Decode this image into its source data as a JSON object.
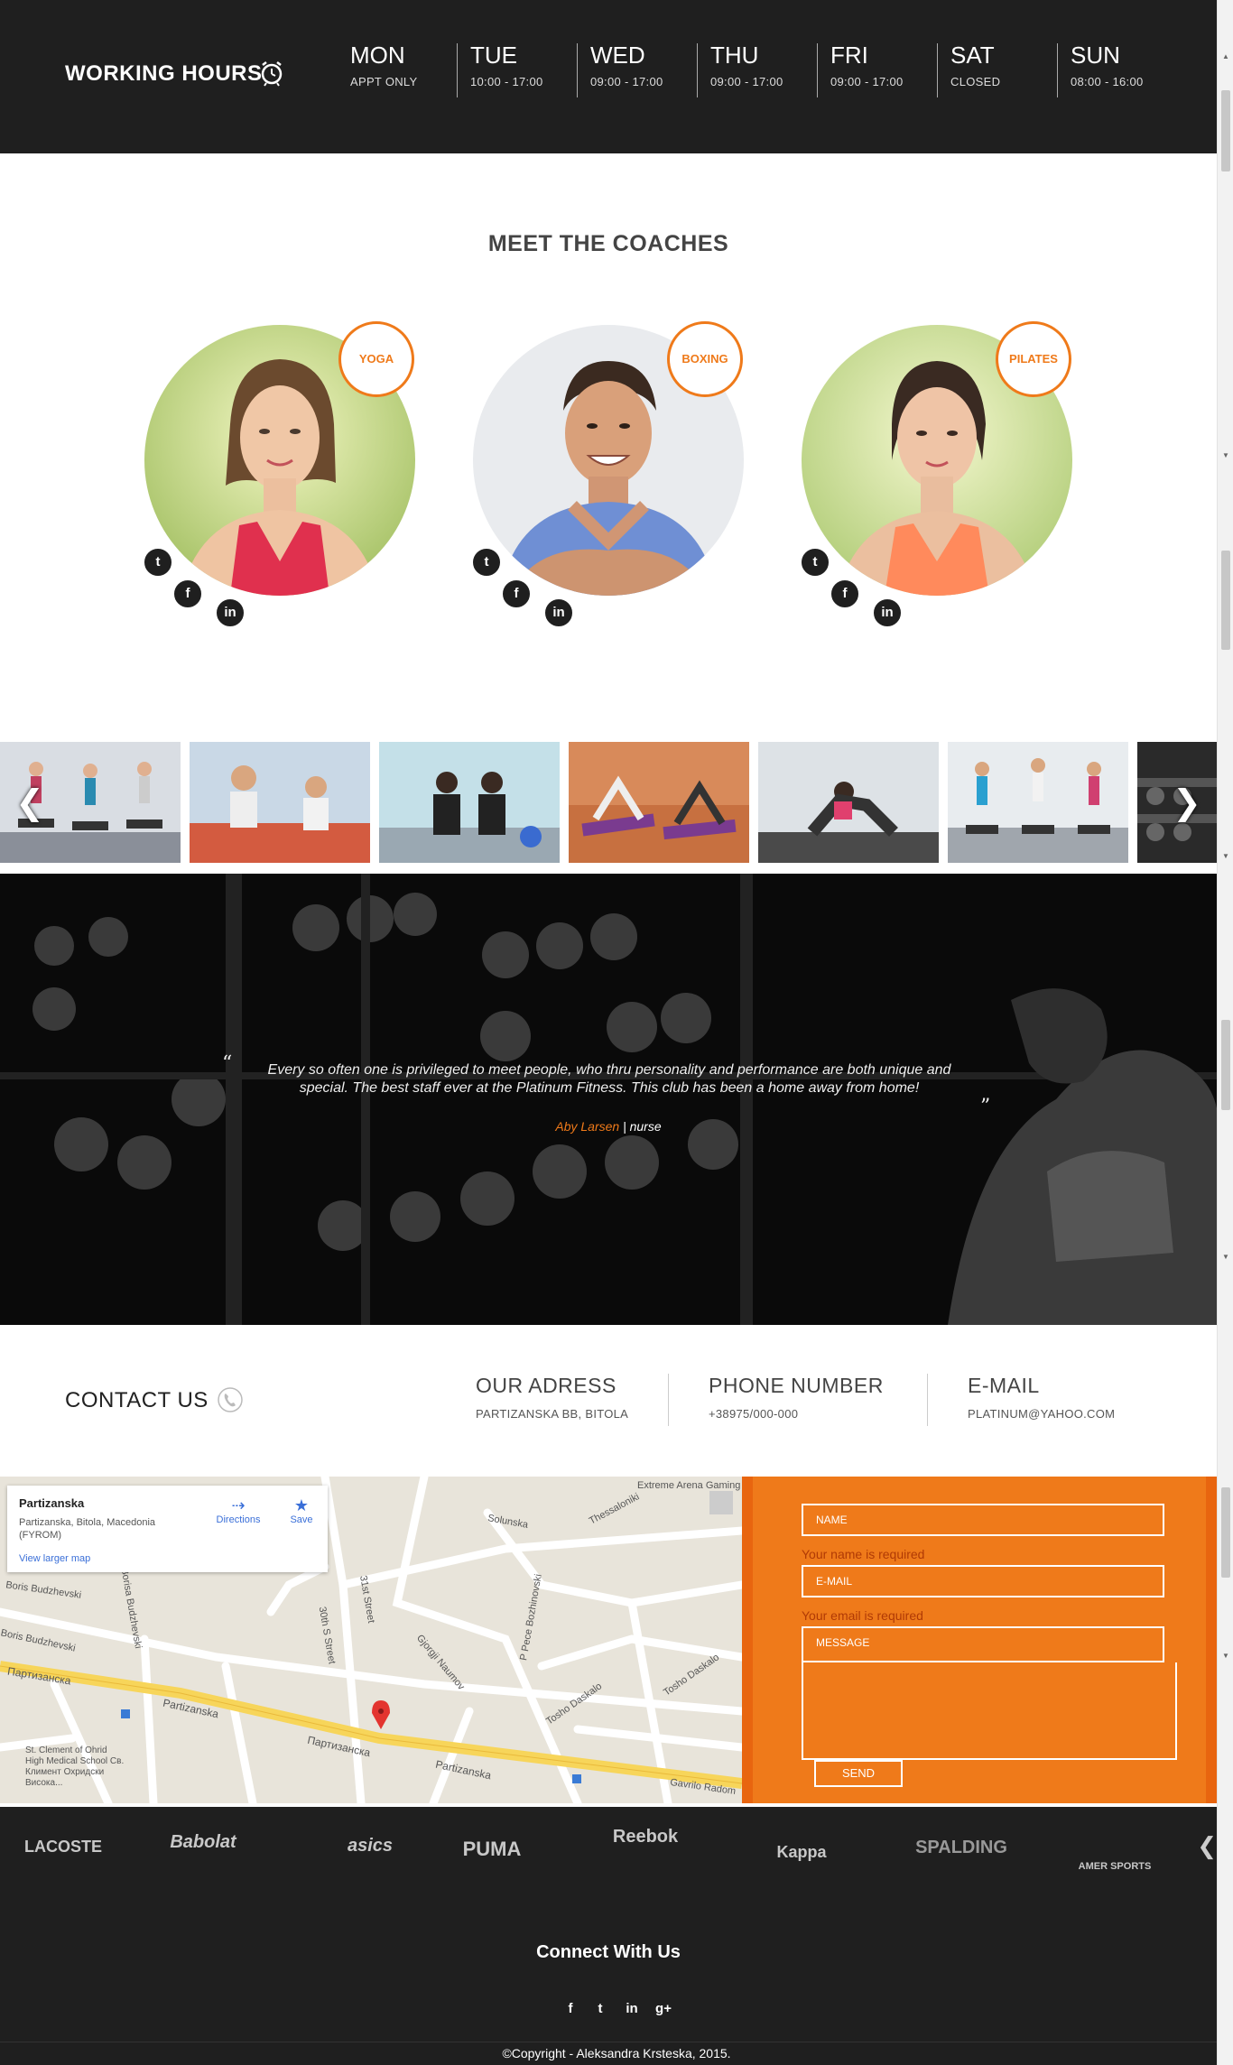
{
  "hours": {
    "title": "WORKING HOURS",
    "icon": "alarm-clock-icon",
    "days": [
      {
        "name": "MON",
        "time": "APPT ONLY"
      },
      {
        "name": "TUE",
        "time": "10:00 - 17:00"
      },
      {
        "name": "WED",
        "time": "09:00 - 17:00"
      },
      {
        "name": "THU",
        "time": "09:00 - 17:00"
      },
      {
        "name": "FRI",
        "time": "09:00 - 17:00"
      },
      {
        "name": "SAT",
        "time": "CLOSED"
      },
      {
        "name": "SUN",
        "time": "08:00 - 16:00"
      }
    ]
  },
  "coaches": {
    "title": "MEET THE COACHES",
    "items": [
      {
        "badge": "YOGA"
      },
      {
        "badge": "BOXING"
      },
      {
        "badge": "PILATES"
      }
    ]
  },
  "gallery": {
    "prev_glyph": "❮",
    "next_glyph": "❯"
  },
  "testimonial": {
    "open_quote": "“",
    "close_quote": "”",
    "text": "Every so often one is privileged to meet people, who thru personality and performance are both unique and special. The best staff ever at the Platinum Fitness. This club has been a home away from home!",
    "author": "Aby Larsen",
    "separator": " | ",
    "role": "nurse"
  },
  "contact": {
    "title": "CONTACT US",
    "address_title": "OUR ADRESS",
    "address_value": "PARTIZANSKA BB, BITOLA",
    "phone_title": "PHONE NUMBER",
    "phone_value": "+38975/000-000",
    "email_title": "E-MAIL",
    "email_value": "PLATINUM@YAHOO.COM"
  },
  "map": {
    "place": "Partizanska",
    "address": "Partizanska, Bitola, Macedonia (FYROM)",
    "directions": "Directions",
    "save": "Save",
    "larger": "View larger map",
    "label_gaming": "Extreme Arena Gaming",
    "label_thessaloniki": "Thessaloniki",
    "label_solunska": "Solunska",
    "label_boris1": "Boris Budzhevski",
    "label_boris2": "Boris Budzhevski",
    "label_boris3": "Borisa Budzhevski",
    "label_partizanska_cyr": "Партизанска",
    "label_partizanska1": "Partizanska",
    "label_partizanska2": "Partizanska",
    "label_partizanska_cyr2": "Партизанска",
    "label_30th": "30th S Street",
    "label_31st": "31st Street",
    "label_naumov": "Gjorgji Naumov",
    "label_pece": "P Pece Bozhinovski",
    "label_tosho1": "Tosho Daskalo",
    "label_tosho2": "Tosho Daskalo",
    "label_gavrilo": "Gavrilo Radom",
    "label_school": "St. Clement of Ohrid High Medical School Св. Климент Охридски Висока..."
  },
  "form": {
    "name_placeholder": "NAME",
    "name_error": "Your name is required",
    "email_placeholder": "E-MAIL",
    "email_error": "Your email is required",
    "message_placeholder": "MESSAGE",
    "send": "SEND"
  },
  "brands": [
    "LACOSTE",
    "Babolat",
    "asics",
    "PUMA",
    "Reebok",
    "Kappa",
    "SPALDING",
    "AMER SPORTS"
  ],
  "footer": {
    "connect": "Connect With Us",
    "copyright": "©Copyright - Aleksandra Krsteska, 2015."
  },
  "colors": {
    "accent": "#ef7a1a",
    "dark": "#1f1f1f"
  }
}
